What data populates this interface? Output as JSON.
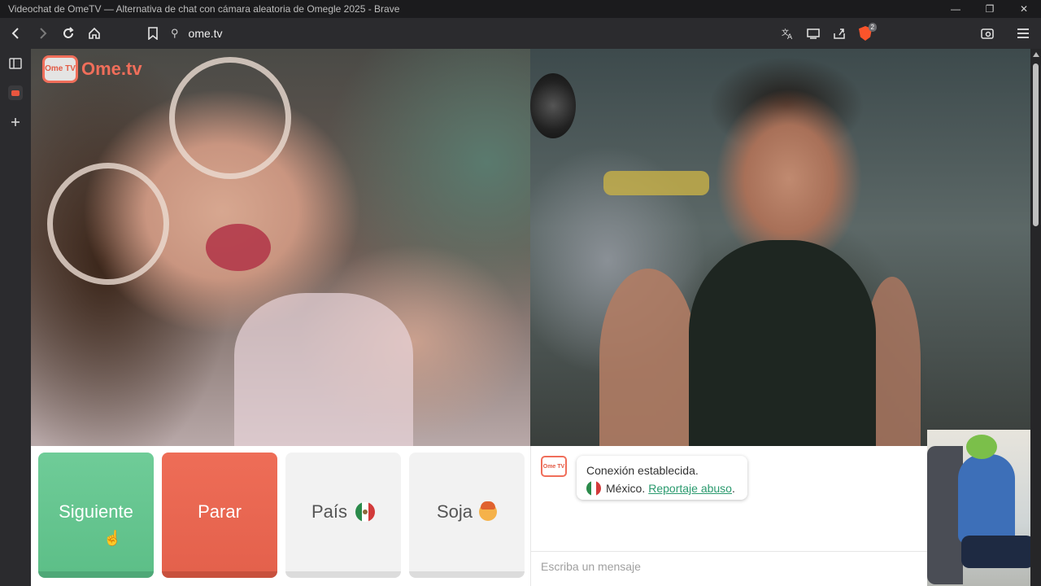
{
  "window": {
    "title": "Videochat de OmeTV — Alternativa de chat con cámara aleatoria de Omegle 2025 - Brave",
    "controls": {
      "minimize": "—",
      "restore": "❐",
      "close": "✕"
    }
  },
  "toolbar": {
    "url": "ome.tv",
    "brave_badge": "2",
    "icons": [
      "back-icon",
      "forward-icon",
      "reload-icon",
      "home-icon",
      "bookmark-icon",
      "site-info-icon",
      "translate-icon",
      "cast-icon",
      "share-icon",
      "brave-shields-icon",
      "wallet-icon",
      "menu-icon"
    ]
  },
  "sidebar": {
    "items": [
      "sidebar-panel-icon",
      "ometv-tab-icon",
      "add-icon"
    ]
  },
  "logo": {
    "badge": "Ome TV",
    "text": "Ome.tv"
  },
  "controls": {
    "next_label": "Siguiente",
    "stop_label": "Parar",
    "country_label": "País",
    "gender_label": "Soja"
  },
  "chat": {
    "logo_badge": "Ome TV",
    "status": "Conexión establecida.",
    "country": "México.",
    "report_link": "Reportaje abuso",
    "report_suffix": ".",
    "input_placeholder": "Escriba un mensaje"
  },
  "colors": {
    "next": "#5dbf88",
    "stop": "#e4614c",
    "brand": "#f06e5a",
    "link": "#2a9a6e"
  }
}
